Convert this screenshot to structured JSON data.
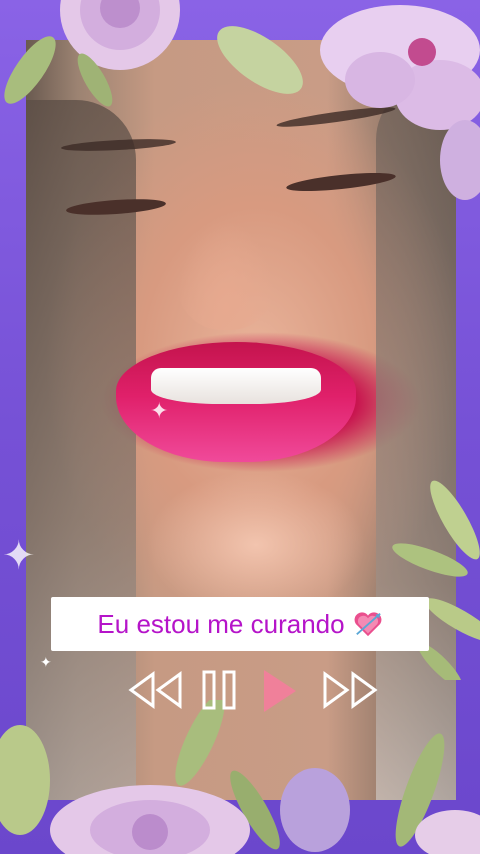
{
  "caption": {
    "text": "Eu estou me curando",
    "emoji_icon": "sparkling-heart-arrow-icon"
  },
  "player": {
    "rewind_icon": "rewind-icon",
    "pause_icon": "pause-icon",
    "play_icon": "play-icon",
    "forward_icon": "fast-forward-icon"
  },
  "colors": {
    "frame": "#7b58d8",
    "caption_text": "#b514c9",
    "caption_bg": "#ffffff",
    "play_accent": "#f0809a",
    "controls_stroke": "#ffffff"
  }
}
